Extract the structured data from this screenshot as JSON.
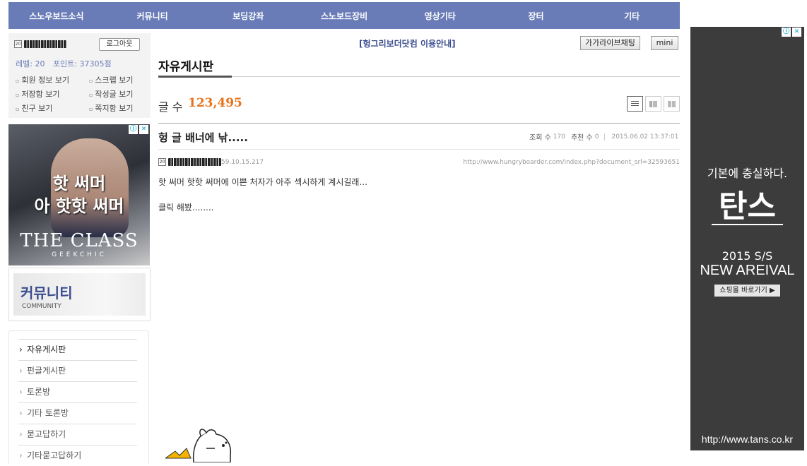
{
  "nav": {
    "items": [
      "스노우보드소식",
      "커뮤니티",
      "보딩강좌",
      "스노보드장비",
      "영상기타",
      "장터",
      "기타"
    ]
  },
  "login": {
    "level_badge": "20",
    "logout_label": "로그아웃",
    "level_label": "레벨: 20",
    "points_label": "포인트: 37305점",
    "links": [
      "회원 정보 보기",
      "스크랩 보기",
      "저장함 보기",
      "작성글 보기",
      "친구 보기",
      "쪽지함 보기"
    ]
  },
  "ad_left": {
    "line1": "핫 써머",
    "line2": "아 핫핫 써머",
    "brand": "THE CLASS",
    "sub": "GEEKCHIC"
  },
  "community": {
    "title": "커뮤니티",
    "subtitle": "COMMUNITY"
  },
  "board_menu": {
    "items": [
      "자유게시판",
      "펀글게시판",
      "토론방",
      "기타 토론방",
      "묻고답하기",
      "기타묻고답하기"
    ]
  },
  "header": {
    "notice": "[헝그리보더닷컴 이용안내]",
    "chat_label": "가가라이브채팅",
    "mini_label": "mini"
  },
  "board": {
    "title": "자유게시판",
    "count_label": "글 수",
    "count_value": "123,495"
  },
  "post": {
    "title": "헝 글 배너에 낚.....",
    "views_label": "조회 수",
    "views": "170",
    "recommend_label": "추천 수",
    "recommend": "0",
    "date": "2015.06.02 13:37:01",
    "author_level": "20",
    "ip": "59.10.15.217",
    "url": "http://www.hungryboarder.com/index.php?document_srl=32593651",
    "body_line1": "핫 써머 핫핫 써머에 이쁜 처자가 아주 섹시하게 계시길래...",
    "body_line2": "클릭 해봤........"
  },
  "ad_right": {
    "line1": "기본에 충실하다.",
    "brand": "탄스",
    "season": "2015 S/S",
    "headline": "NEW AREIVAL",
    "shop_label": "쇼핑몰 바로가기 ▶",
    "url": "http://www.tans.co.kr"
  },
  "colors": {
    "nav_bg": "#6a7cb8",
    "count_accent": "#e8731c",
    "notice_text": "#3b4d8f"
  }
}
